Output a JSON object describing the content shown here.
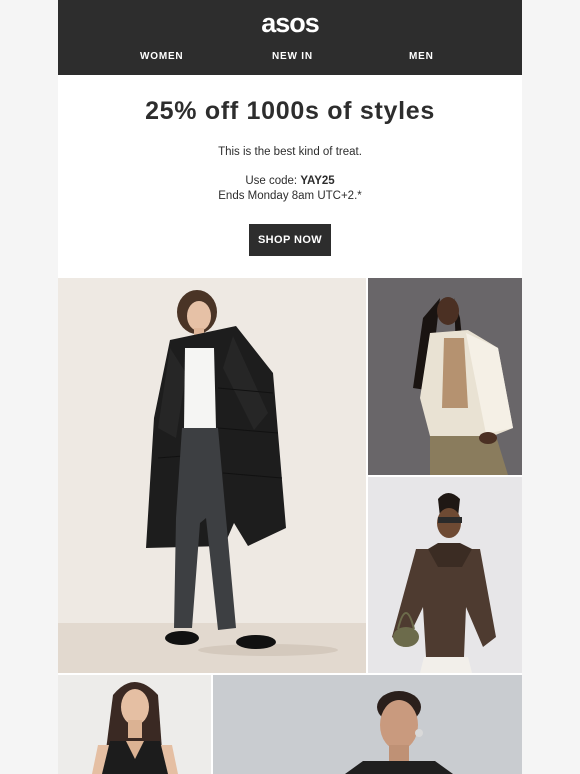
{
  "header": {
    "logo": "asos",
    "nav": [
      "WOMEN",
      "NEW IN",
      "MEN"
    ]
  },
  "hero": {
    "headline": "25% off 1000s of styles",
    "tagline": "This is the best kind of treat.",
    "code_prefix": "Use code: ",
    "code": "YAY25",
    "ends": "Ends Monday 8am UTC+2.*",
    "cta": "SHOP NOW"
  },
  "colors": {
    "header_bg": "#2d2d2d",
    "text": "#2d2d2d",
    "button_bg": "#2d2d2d",
    "page_bg": "#f5f5f5"
  }
}
